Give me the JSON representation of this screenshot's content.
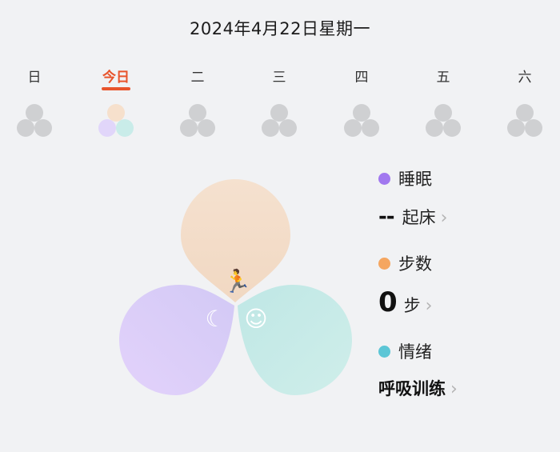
{
  "header": {
    "date": "2024年4月22日星期一"
  },
  "week": {
    "days": [
      {
        "label": "日",
        "active": false
      },
      {
        "label": "今日",
        "active": true
      },
      {
        "label": "二",
        "active": false
      },
      {
        "label": "三",
        "active": false
      },
      {
        "label": "四",
        "active": false
      },
      {
        "label": "五",
        "active": false
      },
      {
        "label": "六",
        "active": false
      }
    ]
  },
  "colors": {
    "accent": "#e8542c",
    "sleep": "#a178ef",
    "steps": "#f5a660",
    "mood": "#5cc6d6",
    "petal_top": "#f4dfcb",
    "petal_left": "#ddd0f9",
    "petal_right": "#c6ebe8"
  },
  "flower": {
    "icons": {
      "top": "running-icon",
      "left": "sleep-moon-icon",
      "right": "smile-face-icon"
    }
  },
  "metrics": {
    "sleep": {
      "label": "睡眠",
      "value": "--",
      "unit": "起床",
      "icon": "chevron-right-icon"
    },
    "steps": {
      "label": "步数",
      "value": "0",
      "unit": "步",
      "icon": "chevron-right-icon"
    },
    "mood": {
      "label": "情绪",
      "action": "呼吸训练",
      "icon": "chevron-right-icon"
    }
  }
}
